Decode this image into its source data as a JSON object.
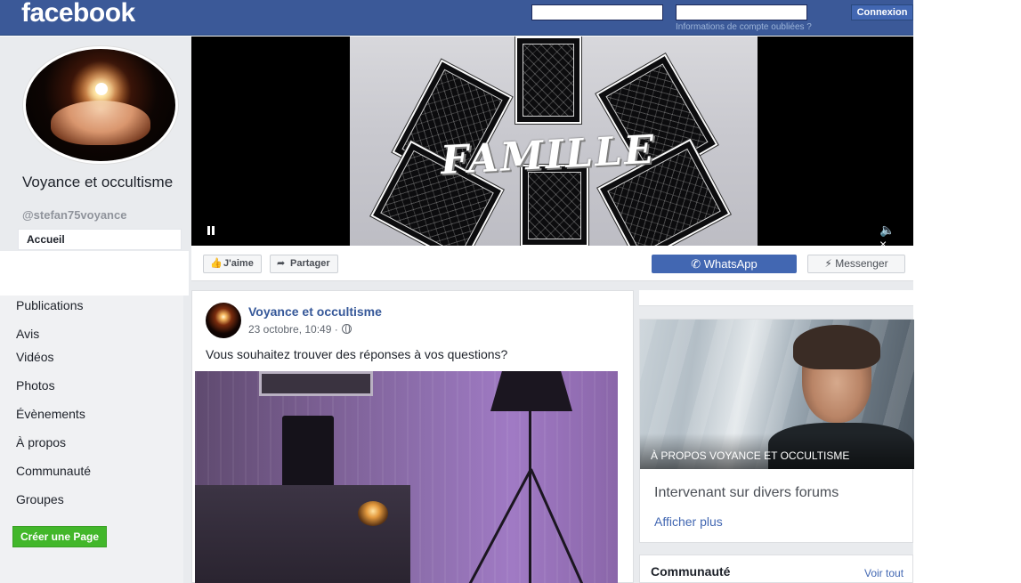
{
  "header": {
    "logo": "facebook",
    "email_value": "",
    "password_value": "",
    "login_label": "Connexion",
    "forgot_label": "Informations de compte oubliées ?"
  },
  "profile": {
    "name": "Voyance et occultisme",
    "handle": "@stefan75voyance",
    "home_tab": "Accueil"
  },
  "sidebar": {
    "items": [
      {
        "label": "Publications"
      },
      {
        "label": "Avis"
      },
      {
        "label": "Vidéos"
      },
      {
        "label": "Photos"
      },
      {
        "label": "Évènements"
      },
      {
        "label": "À propos"
      },
      {
        "label": "Communauté"
      },
      {
        "label": "Groupes"
      }
    ],
    "create_page_label": "Créer une Page"
  },
  "cover": {
    "overlay_text": "FAMILLE"
  },
  "actions": {
    "like_label": "J'aime",
    "share_label": "Partager",
    "whatsapp_label": "WhatsApp",
    "messenger_label": "Messenger"
  },
  "post": {
    "author": "Voyance et occultisme",
    "date": "23 octobre, 10:49 ·",
    "text": "Vous souhaitez trouver des réponses à vos questions?"
  },
  "about": {
    "title": "À PROPOS VOYANCE ET OCCULTISME",
    "description": "Intervenant sur divers forums",
    "more_label": "Afficher plus"
  },
  "community": {
    "title": "Communauté",
    "see_all_label": "Voir tout"
  },
  "colors": {
    "brand_blue": "#3b5998",
    "accent_blue": "#4267b2",
    "green": "#42b72a",
    "page_bg": "#e9ebee"
  }
}
